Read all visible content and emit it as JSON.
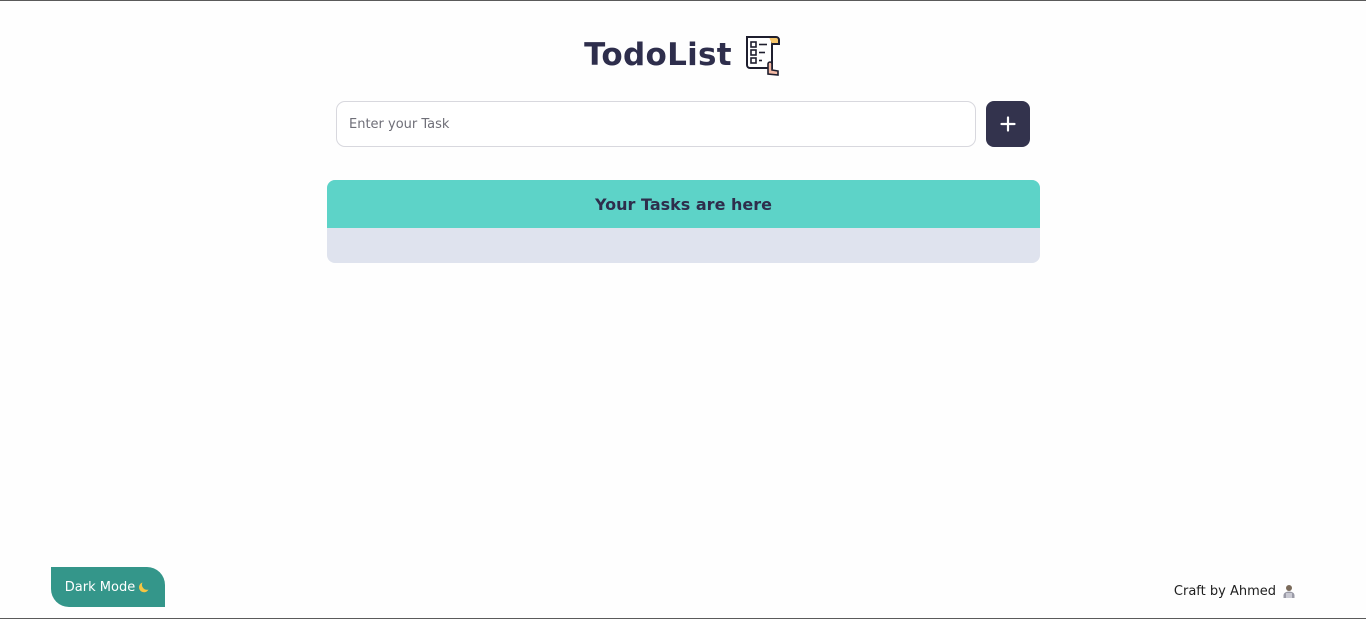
{
  "header": {
    "title": "TodoList",
    "title_icon": "checklist-icon"
  },
  "task_input": {
    "placeholder": "Enter your Task",
    "value": ""
  },
  "add_button": {
    "icon": "plus-icon",
    "symbol": "+"
  },
  "tasks_panel": {
    "heading": "Your Tasks are here",
    "items": []
  },
  "dark_mode": {
    "label": "Dark Mode",
    "icon": "moon-icon"
  },
  "footer": {
    "credit": "Craft by Ahmed",
    "icon": "person-icon"
  },
  "colors": {
    "title": "#2e2e4c",
    "accent_dark": "#33334d",
    "tasks_header": "#5dd3c8",
    "tasks_body": "#dfe3ee",
    "dark_mode_button": "#34968a",
    "background": "#fefefe"
  }
}
